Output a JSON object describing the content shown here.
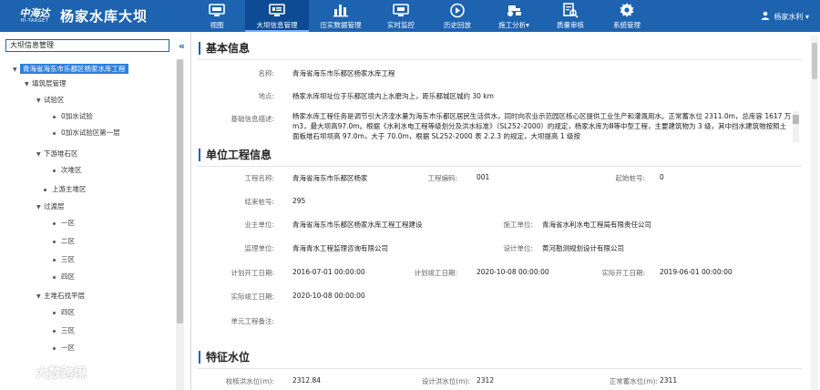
{
  "brand": {
    "logo_cn": "中海达",
    "logo_en": "HI-TARGET",
    "title": "杨家水库大坝"
  },
  "nav": [
    {
      "label": "视图",
      "icon": "monitor-icon"
    },
    {
      "label": "大坝信息管理",
      "icon": "screen-info-icon",
      "active": true
    },
    {
      "label": "压实数据管理",
      "icon": "bar-chart-icon"
    },
    {
      "label": "实时监控",
      "icon": "display-icon"
    },
    {
      "label": "历史回放",
      "icon": "playback-icon"
    },
    {
      "label": "施工分析▾",
      "icon": "roller-icon"
    },
    {
      "label": "质量审核",
      "icon": "document-search-icon"
    },
    {
      "label": "系统管理",
      "icon": "gear-icon"
    }
  ],
  "user": {
    "name": "杨家水利 ▾"
  },
  "sidebar": {
    "header": "大坝信息管理",
    "collapse": "«",
    "tree": [
      {
        "label": "青海省海东市乐都区杨家水库工程",
        "level": 0,
        "toggle": "▼",
        "selected": true
      },
      {
        "label": "填筑层管理",
        "level": 1,
        "toggle": "▼"
      },
      {
        "label": "试验区",
        "level": 2,
        "toggle": "▼"
      },
      {
        "label": "0加水试验",
        "level": 3
      },
      {
        "label": "0加水试验区第一层",
        "level": 3
      },
      {
        "label": "下游堆石区",
        "level": 2,
        "toggle": "▼"
      },
      {
        "label": "次堆区",
        "level": 3
      },
      {
        "label": "上游主堆区",
        "level": 2
      },
      {
        "label": "过渡层",
        "level": 2,
        "toggle": "▼"
      },
      {
        "label": "一区",
        "level": 3
      },
      {
        "label": "二区",
        "level": 3
      },
      {
        "label": "三区",
        "level": 3
      },
      {
        "label": "四区",
        "level": 3
      },
      {
        "label": "主堆石找平层",
        "level": 2,
        "toggle": "▼"
      },
      {
        "label": "四区",
        "level": 3
      },
      {
        "label": "三区",
        "level": 3
      },
      {
        "label": "一区",
        "level": 3
      }
    ]
  },
  "basic": {
    "title": "基本信息",
    "name_label": "名称:",
    "name_value": "青海省海东市乐都区杨家水库工程",
    "location_label": "地点:",
    "location_value": "杨家水库坝址位于乐都区境内上水磨沟上，距乐都城区城约 30 km",
    "desc_label": "基础信息描述:",
    "desc_value": "杨家水库工程任务是调节引大济湟水量为海东市乐都区居民生活供水，同时向农业示范园区核心区提供工业生产和灌溉用水。正常蓄水位 2311.0m，总库容 1617 万 m3，最大坝高97.0m。根据《水利水电工程等级划分及洪水标准》（SL252-2000）的规定，杨家水库为Ⅲ等中型工程，主要建筑物为 3 级，其中挡水建筑物按照土面板堆石坝坝高 97.0m，大于 70.0m，根据 SL252-2000 表 2.2.3 的规定，大坝提高 1 级按"
  },
  "unit": {
    "title": "单位工程信息",
    "project_name_label": "工程名称:",
    "project_name_value": "青海省海东市乐都区杨家",
    "project_code_label": "工程编码:",
    "project_code_value": "001",
    "start_station_label": "起始桩号:",
    "start_station_value": "0",
    "end_station_label": "结束桩号:",
    "end_station_value": "295",
    "owner_label": "业主单位:",
    "owner_value": "青海省海东市乐都区杨家水库工程工程建设",
    "construction_label": "施工单位:",
    "construction_value": "青海省水利水电工程局有限责任公司",
    "supervision_label": "监理单位:",
    "supervision_value": "青海青水工程监理咨询有限公司",
    "design_label": "设计单位:",
    "design_value": "黄河勘测规划设计有限公司",
    "plan_start_label": "计划开工日期:",
    "plan_start_value": "2016-07-01 00:00:00",
    "plan_end_label": "计划竣工日期:",
    "plan_end_value": "2020-10-08 00:00:00",
    "actual_start_label": "实际开工日期:",
    "actual_start_value": "2019-06-01 00:00:00",
    "actual_end_label": "实际竣工日期:",
    "actual_end_value": "2020-10-08 00:00:00",
    "remark_label": "单元工程备注:",
    "remark_value": ""
  },
  "water": {
    "title": "特征水位",
    "check_flood_label": "校核洪水位(m):",
    "check_flood_value": "2312.84",
    "design_flood_label": "设计洪水位(m):",
    "design_flood_value": "2312",
    "normal_label": "正常蓄水位(m):",
    "normal_value": "2311"
  },
  "watermark": {
    "text": "大数跨境"
  },
  "colors": {
    "topbar": "#1d63b0",
    "active_nav": "#0d4c94",
    "selected_node": "#2d7fde"
  }
}
